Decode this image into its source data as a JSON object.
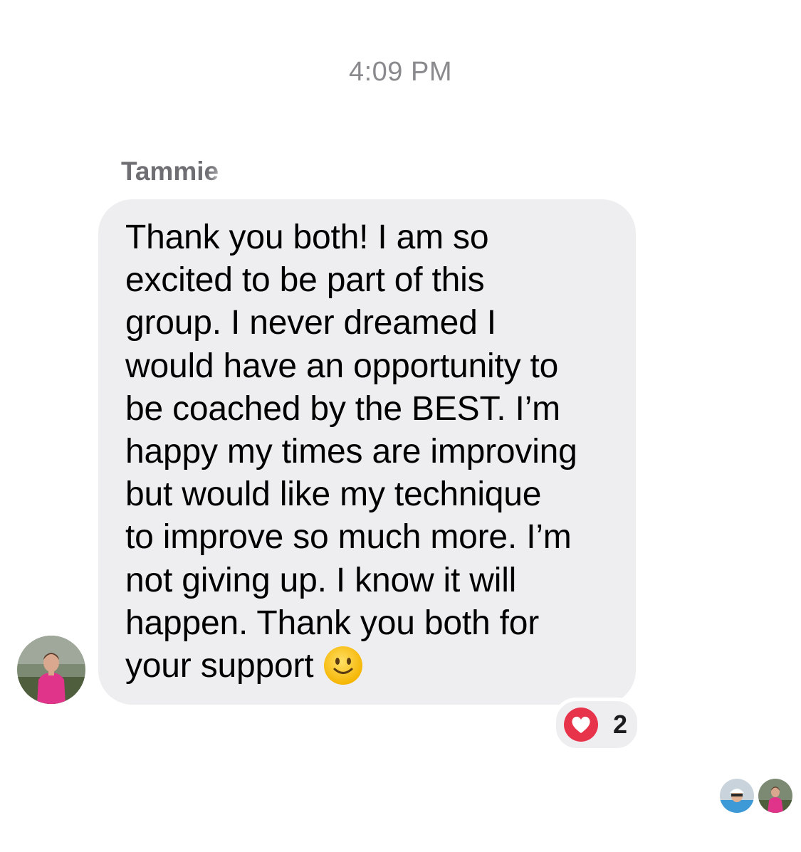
{
  "thread": {
    "timestamp": "4:09 PM"
  },
  "message": {
    "sender_name": "Tammie",
    "text": "Thank you both! I am so\nexcited to be part of this\ngroup. I never dreamed I\nwould have an opportunity to\nbe coached by the BEST. I’m\nhappy my times are improving\nbut would like my technique\nto improve so much more. I’m\nnot giving up. I know it will\nhappen. Thank you both for\nyour support",
    "trailing_emoji": "slightly-smiling-face",
    "reaction": {
      "icon": "heart-icon",
      "count": "2",
      "color": "#e8344a"
    }
  },
  "colors": {
    "bubble_bg": "#eeeef1",
    "timestamp": "#8a8a8e",
    "sender_name": "#6e6e73"
  },
  "read_receipts": {
    "icons": [
      "user-avatar-blue-hat",
      "user-avatar-pink-jacket"
    ]
  }
}
